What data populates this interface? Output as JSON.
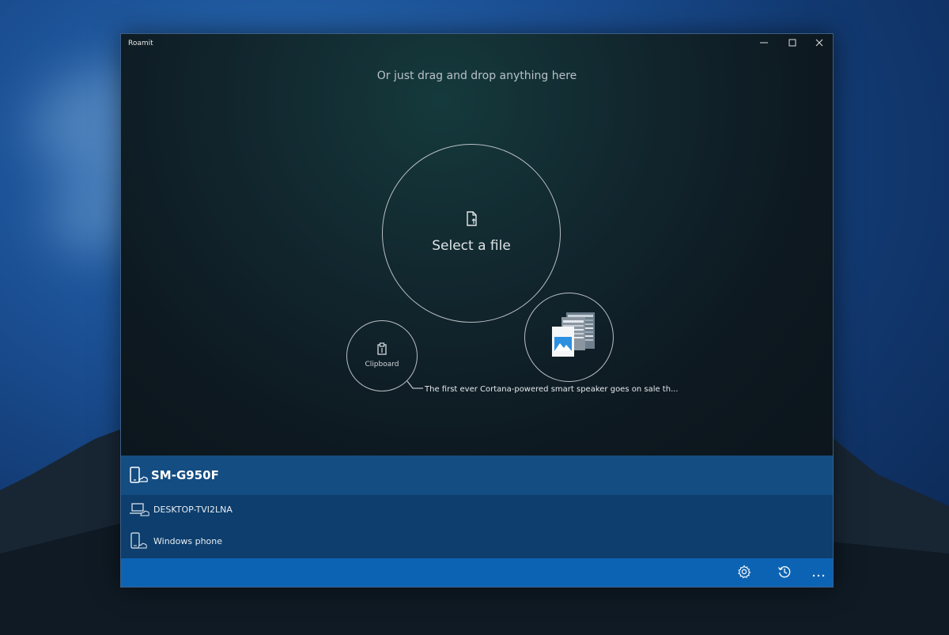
{
  "window": {
    "title": "Roamit",
    "controls": {
      "minimize_icon": "minimize-icon",
      "maximize_icon": "maximize-icon",
      "close_icon": "close-icon"
    }
  },
  "main": {
    "drag_hint": "Or just drag and drop anything here",
    "select_file_label": "Select a file",
    "clipboard_label": "Clipboard",
    "clipboard_preview": "The first ever Cortana-powered smart speaker goes on sale th..."
  },
  "devices": [
    {
      "name": "SM-G950F",
      "icon": "phone-cloud-icon",
      "active": true
    },
    {
      "name": "DESKTOP-TVI2LNA",
      "icon": "laptop-cloud-icon",
      "active": false
    },
    {
      "name": "Windows phone",
      "icon": "phone-cloud-icon",
      "active": false
    }
  ],
  "bottom_bar": {
    "icons": [
      "settings-icon",
      "history-icon",
      "more-icon"
    ]
  },
  "colors": {
    "accent": "#0d63b3",
    "device_active": "#134d82",
    "device_row": "#0d3e6d",
    "main_bg": "#0d1a24"
  }
}
